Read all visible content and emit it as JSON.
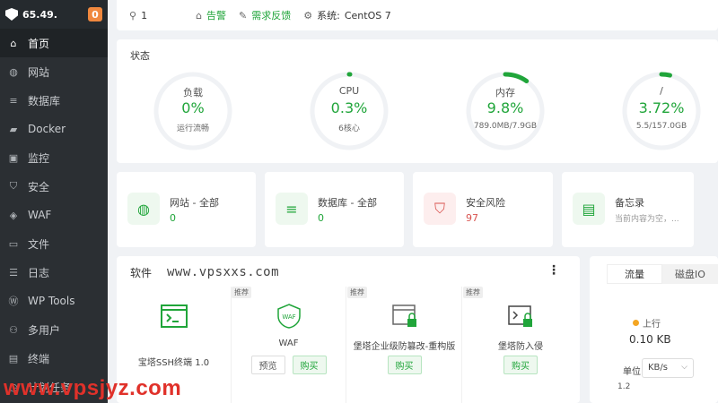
{
  "sidebar": {
    "ip": "65.49.",
    "badge": "0",
    "items": [
      {
        "label": "首页",
        "icon": "home-icon"
      },
      {
        "label": "网站",
        "icon": "globe-icon"
      },
      {
        "label": "数据库",
        "icon": "database-icon"
      },
      {
        "label": "Docker",
        "icon": "docker-icon"
      },
      {
        "label": "监控",
        "icon": "monitor-icon"
      },
      {
        "label": "安全",
        "icon": "shield-icon"
      },
      {
        "label": "WAF",
        "icon": "waf-icon"
      },
      {
        "label": "文件",
        "icon": "folder-icon"
      },
      {
        "label": "日志",
        "icon": "log-icon"
      },
      {
        "label": "WP Tools",
        "icon": "wordpress-icon"
      },
      {
        "label": "多用户",
        "icon": "users-icon"
      },
      {
        "label": "终端",
        "icon": "terminal-icon"
      },
      {
        "label": "计划任务",
        "icon": "clock-icon"
      }
    ]
  },
  "topbar": {
    "user": "1",
    "alert": "告警",
    "feedback": "需求反馈",
    "system_label": "系统:",
    "system": "CentOS 7"
  },
  "status": {
    "title": "状态",
    "gauges": [
      {
        "label": "负载",
        "value": "0%",
        "sub": "运行流畅",
        "fraction": 0.0
      },
      {
        "label": "CPU",
        "value": "0.3%",
        "sub": "6核心",
        "fraction": 0.003
      },
      {
        "label": "内存",
        "value": "9.8%",
        "sub": "789.0MB/7.9GB",
        "fraction": 0.098
      },
      {
        "label": "/",
        "value": "3.72%",
        "sub": "5.5/157.0GB",
        "fraction": 0.0372
      }
    ],
    "color": "#20a53a"
  },
  "overview": [
    {
      "title": "网站 - 全部",
      "value": "0",
      "icon": "globe-icon"
    },
    {
      "title": "数据库 - 全部",
      "value": "0",
      "icon": "database-icon"
    },
    {
      "title": "安全风险",
      "value": "97",
      "icon": "shield-alert-icon"
    },
    {
      "title": "备忘录",
      "value": "当前内容为空，...",
      "icon": "memo-icon"
    }
  ],
  "software": {
    "title": "软件",
    "tag": "推荐",
    "preview": "预览",
    "buy": "购买",
    "items": [
      {
        "name": "宝塔SSH终端 1.0"
      },
      {
        "name": "WAF"
      },
      {
        "name": "堡塔企业级防篡改-重构版"
      },
      {
        "name": "堡塔防入侵"
      }
    ]
  },
  "traffic": {
    "tab_flow": "流量",
    "tab_disk": "磁盘IO",
    "up_label": "上行",
    "up_value": "0.10 KB",
    "unit_label": "单位",
    "unit_value": "KB/s",
    "y_tick": "1.2"
  },
  "watermarks": {
    "site": "www.vpsxxs.com",
    "brand": "www.vpsjyz.com"
  }
}
